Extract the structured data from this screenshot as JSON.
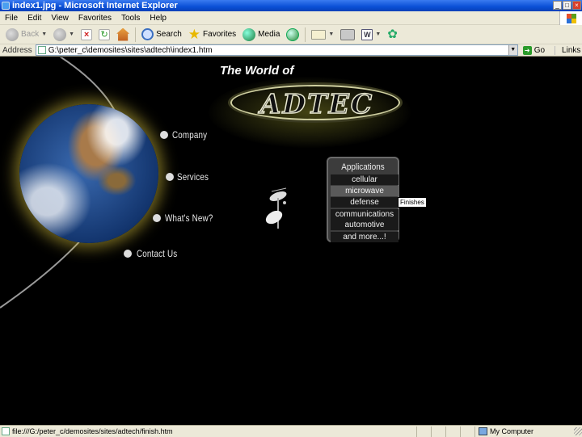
{
  "window": {
    "title": "index1.jpg - Microsoft Internet Explorer"
  },
  "menu": [
    "File",
    "Edit",
    "View",
    "Favorites",
    "Tools",
    "Help"
  ],
  "toolbar": {
    "back": "Back",
    "search": "Search",
    "favorites": "Favorites",
    "media": "Media"
  },
  "address": {
    "label": "Address",
    "url": "G:\\peter_c\\demosites\\sites\\adtech\\index1.htm",
    "go": "Go",
    "links": "Links"
  },
  "page": {
    "heading": "The World of",
    "logo": "ADTEC",
    "nav": [
      "Company",
      "Services",
      "What's New?",
      "Contact Us"
    ],
    "applications": {
      "title": "Applications",
      "items": [
        "cellular",
        "microwave",
        "defense",
        "communications",
        "automotive",
        "and more...!"
      ],
      "hovered_index": 1
    },
    "tooltip": "Finishes"
  },
  "status": {
    "text": "file:///G:/peter_c/demosites/sites/adtech/finish.htm",
    "zone": "My Computer"
  }
}
